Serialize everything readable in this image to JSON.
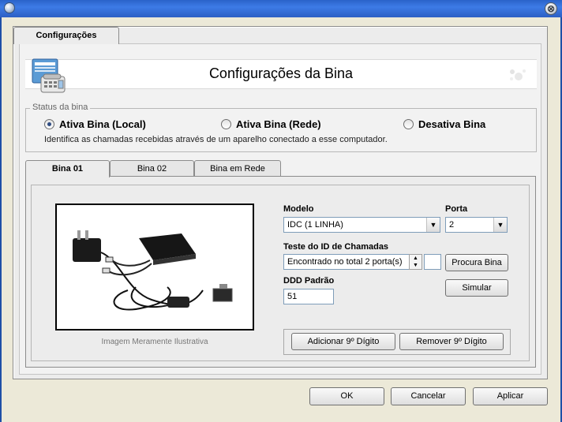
{
  "window": {
    "close_glyph": "⊗"
  },
  "outer_tab": {
    "label": "Configurações"
  },
  "banner": {
    "title": "Configurações da Bina",
    "icon": "phone-fax-icon"
  },
  "status": {
    "legend": "Status da bina",
    "options": [
      {
        "label": "Ativa Bina (Local)",
        "selected": true
      },
      {
        "label": "Ativa Bina (Rede)",
        "selected": false
      },
      {
        "label": "Desativa Bina",
        "selected": false
      }
    ],
    "description": "Identifica as chamadas recebidas através de um aparelho conectado a esse computador."
  },
  "tabs": [
    {
      "label": "Bina 01",
      "active": true
    },
    {
      "label": "Bina 02",
      "active": false
    },
    {
      "label": "Bina em Rede",
      "active": false
    }
  ],
  "device": {
    "caption": "Imagem Meramente Ilustrativa",
    "modelo_label": "Modelo",
    "modelo_value": "IDC (1 LINHA)",
    "porta_label": "Porta",
    "porta_value": "2",
    "teste_label": "Teste do ID de Chamadas",
    "teste_value": "Encontrado no total 2 porta(s)",
    "teste_extra": "",
    "procura_button": "Procura Bina",
    "ddd_label": "DDD Padrão",
    "ddd_value": "51",
    "simular_button": "Simular",
    "adicionar_button": "Adicionar 9º Dígito",
    "remover_button": "Remover 9º Dígito"
  },
  "footer": {
    "ok": "OK",
    "cancel": "Cancelar",
    "apply": "Aplicar"
  },
  "colors": {
    "titlebar": "#2c5fc4",
    "radio_dot": "#2f4c82",
    "panel": "#ececec"
  }
}
